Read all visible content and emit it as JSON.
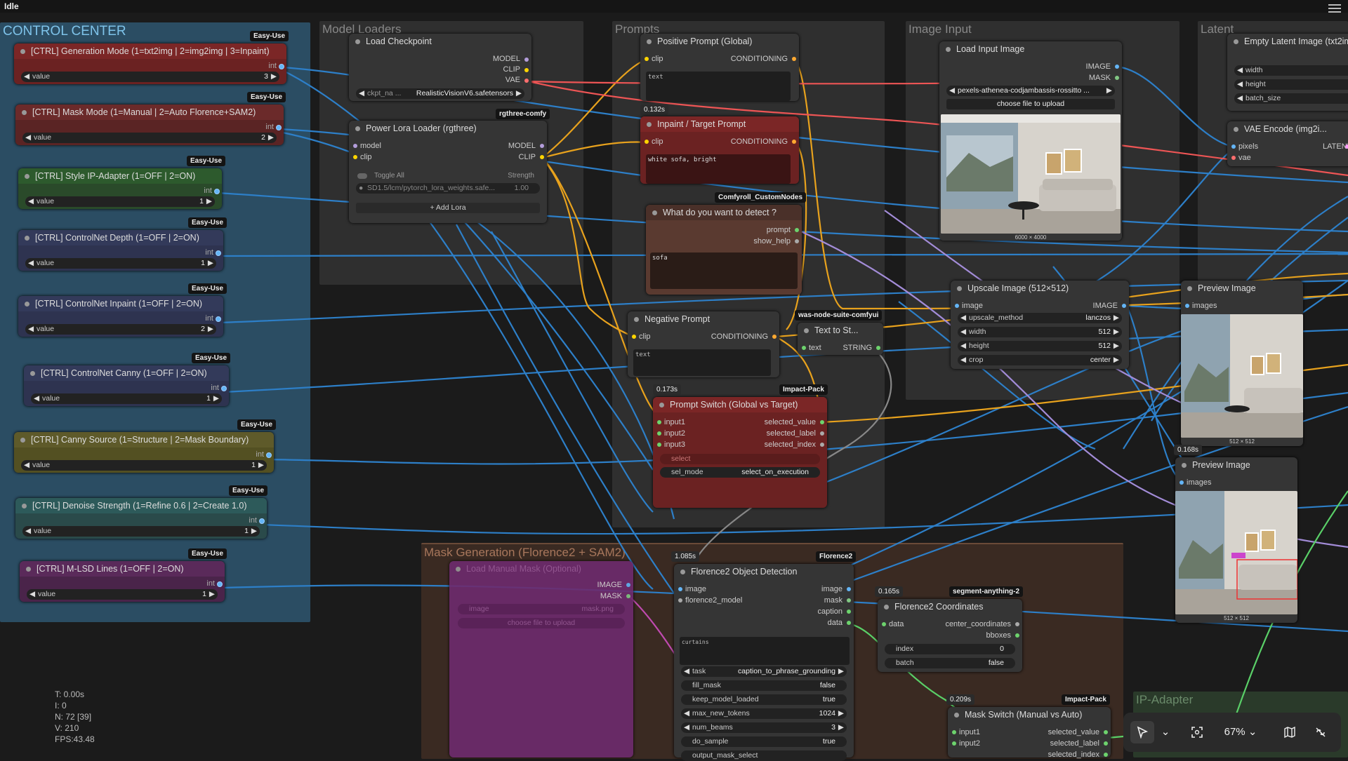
{
  "status": "Idle",
  "groups": {
    "control_center": "CONTROL CENTER",
    "model_loaders": "Model Loaders",
    "prompts": "Prompts",
    "image_input": "Image Input",
    "latent": "Latent",
    "mask_generation": "Mask Generation (Florence2 + SAM2)",
    "ip_adapter": "IP-Adapter"
  },
  "ctrl_nodes": [
    {
      "title": "[CTRL] Generation Mode (1=txt2img | 2=img2img | 3=Inpaint)",
      "value": "3",
      "badge": "Easy-Use"
    },
    {
      "title": "[CTRL] Mask Mode (1=Manual | 2=Auto Florence+SAM2)",
      "value": "2",
      "badge": "Easy-Use"
    },
    {
      "title": "[CTRL] Style IP-Adapter (1=OFF | 2=ON)",
      "value": "1",
      "badge": "Easy-Use"
    },
    {
      "title": "[CTRL] ControlNet Depth (1=OFF | 2=ON)",
      "value": "1",
      "badge": "Easy-Use"
    },
    {
      "title": "[CTRL] ControlNet Inpaint (1=OFF | 2=ON)",
      "value": "2",
      "badge": "Easy-Use"
    },
    {
      "title": "[CTRL] ControlNet Canny (1=OFF | 2=ON)",
      "value": "1",
      "badge": "Easy-Use"
    },
    {
      "title": "[CTRL] Canny Source (1=Structure | 2=Mask Boundary)",
      "value": "1",
      "badge": "Easy-Use"
    },
    {
      "title": "[CTRL] Denoise Strength (1=Refine 0.6 | 2=Create 1.0)",
      "value": "1",
      "badge": "Easy-Use"
    },
    {
      "title": "[CTRL] M-LSD Lines (1=OFF | 2=ON)",
      "value": "1",
      "badge": "Easy-Use"
    }
  ],
  "common": {
    "int": "int",
    "value": "value"
  },
  "load_checkpoint": {
    "title": "Load Checkpoint",
    "out_model": "MODEL",
    "out_clip": "CLIP",
    "out_vae": "VAE",
    "ckpt_label": "ckpt_na ...",
    "ckpt_value": "RealisticVisionV6.safetensors"
  },
  "power_lora": {
    "title": "Power Lora Loader (rgthree)",
    "badge": "rgthree-comfy",
    "in_model": "model",
    "in_clip": "clip",
    "out_model": "MODEL",
    "out_clip": "CLIP",
    "toggle_all": "Toggle All",
    "strength": "Strength",
    "lora_name": "SD1.5/lcm/pytorch_lora_weights.safe...",
    "lora_strength": "1.00",
    "add_lora": "+ Add Lora"
  },
  "positive_prompt": {
    "title": "Positive Prompt (Global)",
    "in_clip": "clip",
    "out": "CONDITIONING",
    "text": "text",
    "timing": "0.132s"
  },
  "inpaint_prompt": {
    "title": "Inpaint / Target Prompt",
    "in_clip": "clip",
    "out": "CONDITIONING",
    "text": "white sofa, bright",
    "badge": "Comfyroll_CustomNodes"
  },
  "detect": {
    "title": "What do you want to detect ?",
    "out_prompt": "prompt",
    "out_help": "show_help",
    "text": "sofa"
  },
  "negative_prompt": {
    "title": "Negative Prompt",
    "in_clip": "clip",
    "out": "CONDITIONING",
    "text": "text",
    "timing": "0.173s"
  },
  "text_to_string": {
    "title": "Text to St...",
    "in_text": "text",
    "out": "STRING",
    "badge": "was-node-suite-comfyui"
  },
  "prompt_switch": {
    "title": "Prompt Switch (Global vs Target)",
    "badge": "Impact-Pack",
    "inputs": [
      "input1",
      "input2",
      "input3"
    ],
    "outputs": [
      "selected_value",
      "selected_label",
      "selected_index"
    ],
    "select": "select",
    "sel_mode": "sel_mode",
    "sel_mode_value": "select_on_execution"
  },
  "load_input_image": {
    "title": "Load Input Image",
    "out_image": "IMAGE",
    "out_mask": "MASK",
    "file": "pexels-athenea-codjambassis-rossitto ...",
    "upload": "choose file to upload",
    "dims": "6000 × 4000"
  },
  "empty_latent": {
    "title": "Empty Latent Image (txt2im",
    "width": "width",
    "height": "height",
    "batch": "batch_size"
  },
  "vae_encode": {
    "title": "VAE Encode (img2i...",
    "in_pixels": "pixels",
    "in_vae": "vae",
    "out": "LATENT"
  },
  "upscale": {
    "title": "Upscale Image (512×512)",
    "in_image": "image",
    "out_image": "IMAGE",
    "method_label": "upscale_method",
    "method": "lanczos",
    "width_label": "width",
    "width": "512",
    "height_label": "height",
    "height": "512",
    "crop_label": "crop",
    "crop": "center"
  },
  "preview1": {
    "title": "Preview Image",
    "in": "images",
    "dims": "512 × 512",
    "timing": "0.168s"
  },
  "preview2": {
    "title": "Preview Image",
    "in": "images",
    "dims": "512 × 512"
  },
  "load_manual_mask": {
    "title": "Load Manual Mask (Optional)",
    "out_image": "IMAGE",
    "out_mask": "MASK",
    "w_image": "image",
    "w_image_val": "mask.png",
    "upload": "choose file to upload"
  },
  "florence_od": {
    "title": "Florence2 Object Detection",
    "badge": "Florence2",
    "timing": "1.085s",
    "in_image": "image",
    "in_model": "florence2_model",
    "outs": [
      "image",
      "mask",
      "caption",
      "data"
    ],
    "text": "curtains",
    "task_label": "task",
    "task": "caption_to_phrase_grounding",
    "fill_mask": "fill_mask",
    "fill_mask_val": "false",
    "keep_model": "keep_model_loaded",
    "keep_model_val": "true",
    "max_tokens": "max_new_tokens",
    "max_tokens_val": "1024",
    "num_beams": "num_beams",
    "num_beams_val": "3",
    "do_sample": "do_sample",
    "do_sample_val": "true",
    "output_mask": "output_mask_select"
  },
  "florence_coords": {
    "title": "Florence2 Coordinates",
    "badge": "segment-anything-2",
    "timing": "0.165s",
    "in": "data",
    "out1": "center_coordinates",
    "out2": "bboxes",
    "index": "index",
    "index_val": "0",
    "batch": "batch",
    "batch_val": "false"
  },
  "mask_switch": {
    "title": "Mask Switch (Manual vs Auto)",
    "badge": "Impact-Pack",
    "timing": "0.209s",
    "inputs": [
      "input1",
      "input2"
    ],
    "outputs": [
      "selected_value",
      "selected_label",
      "selected_index"
    ]
  },
  "stats": [
    "T: 0.00s",
    "I: 0",
    "N: 72 [39]",
    "V: 210",
    "FPS:43.48"
  ],
  "zoom": "67%"
}
